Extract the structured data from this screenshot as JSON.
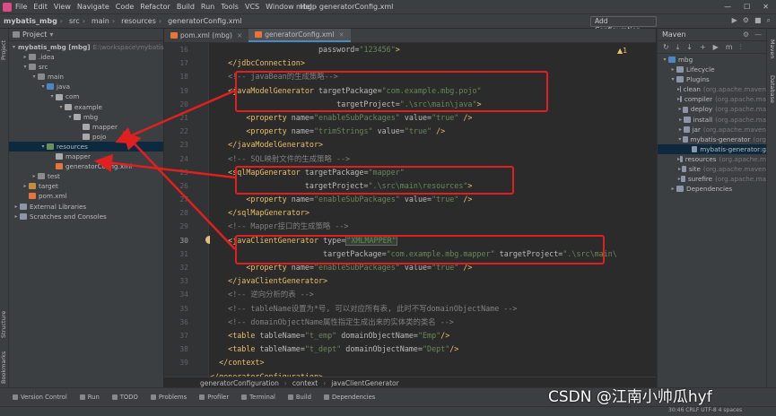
{
  "menubar": {
    "items": [
      "File",
      "Edit",
      "View",
      "Navigate",
      "Code",
      "Refactor",
      "Build",
      "Run",
      "Tools",
      "VCS",
      "Window",
      "Help"
    ],
    "title": "mbg - generatorConfig.xml"
  },
  "navbar": {
    "crumbs": [
      "mybatis_mbg",
      "src",
      "main",
      "resources",
      "generatorConfig.xml"
    ],
    "add_config": "Add Configuration..."
  },
  "left_tabs": {
    "project": "Project",
    "structure": "Structure",
    "bookmarks": "Bookmarks"
  },
  "project": {
    "header": "Project",
    "tree": [
      {
        "label": "mybatis_mbg [mbg]",
        "hint": "E:\\workspace\\mybatis",
        "depth": 0,
        "icon": "folder",
        "open": true,
        "bold": true
      },
      {
        "label": ".idea",
        "depth": 1,
        "icon": "folder",
        "open": false
      },
      {
        "label": "src",
        "depth": 1,
        "icon": "folder",
        "open": true
      },
      {
        "label": "main",
        "depth": 2,
        "icon": "folder",
        "open": true
      },
      {
        "label": "java",
        "depth": 3,
        "icon": "src",
        "open": true
      },
      {
        "label": "com",
        "depth": 4,
        "icon": "pkg",
        "open": true
      },
      {
        "label": "example",
        "depth": 5,
        "icon": "pkg",
        "open": true
      },
      {
        "label": "mbg",
        "depth": 6,
        "icon": "pkg",
        "open": true
      },
      {
        "label": "mapper",
        "depth": 7,
        "icon": "pkg",
        "open": null
      },
      {
        "label": "pojo",
        "depth": 7,
        "icon": "pkg",
        "open": null
      },
      {
        "label": "resources",
        "depth": 3,
        "icon": "res",
        "open": true,
        "selected": true
      },
      {
        "label": "mapper",
        "depth": 4,
        "icon": "pkg",
        "open": null
      },
      {
        "label": "generatorConfig.xml",
        "depth": 4,
        "icon": "xml",
        "open": null
      },
      {
        "label": "test",
        "depth": 2,
        "icon": "folder",
        "open": false
      },
      {
        "label": "target",
        "depth": 1,
        "icon": "tgt",
        "open": false
      },
      {
        "label": "pom.xml",
        "depth": 1,
        "icon": "xml",
        "open": null
      },
      {
        "label": "External Libraries",
        "depth": 0,
        "icon": "lib",
        "open": false
      },
      {
        "label": "Scratches and Consoles",
        "depth": 0,
        "icon": "lib",
        "open": false
      }
    ]
  },
  "editor": {
    "tabs": [
      {
        "label": "pom.xml (mbg)",
        "active": false
      },
      {
        "label": "generatorConfig.xml",
        "active": true
      }
    ],
    "warnings": "▲1",
    "lines": [
      16,
      17,
      18,
      19,
      20,
      21,
      22,
      23,
      24,
      25,
      26,
      27,
      28,
      29,
      30,
      31,
      32,
      33,
      34,
      35,
      36,
      37,
      38,
      39
    ],
    "code": [
      [
        [
          "att",
          "                        password="
        ],
        [
          "val",
          "\"123456\""
        ],
        [
          "tag",
          ">"
        ]
      ],
      [
        [
          "tag",
          "    </jdbcConnection>"
        ]
      ],
      [
        [
          "cmt",
          "    <!-- javaBean的生成策略-->"
        ]
      ],
      [
        [
          "tag",
          "    <javaModelGenerator "
        ],
        [
          "att",
          "targetPackage="
        ],
        [
          "val",
          "\"com.example.mbg.pojo\""
        ]
      ],
      [
        [
          "att",
          "                            targetProject="
        ],
        [
          "val",
          "\".\\src\\main\\java\""
        ],
        [
          "tag",
          ">"
        ]
      ],
      [
        [
          "tag",
          "        <property "
        ],
        [
          "att",
          "name="
        ],
        [
          "val",
          "\"enableSubPackages\" "
        ],
        [
          "att",
          "value="
        ],
        [
          "val",
          "\"true\" "
        ],
        [
          "tag",
          "/>"
        ]
      ],
      [
        [
          "tag",
          "        <property "
        ],
        [
          "att",
          "name="
        ],
        [
          "val",
          "\"trimStrings\" "
        ],
        [
          "att",
          "value="
        ],
        [
          "val",
          "\"true\" "
        ],
        [
          "tag",
          "/>"
        ]
      ],
      [
        [
          "tag",
          "    </javaModelGenerator>"
        ]
      ],
      [
        [
          "cmt",
          "    <!-- SQL映射文件的生成策略 -->"
        ]
      ],
      [
        [
          "tag",
          "    <sqlMapGenerator "
        ],
        [
          "att",
          "targetPackage="
        ],
        [
          "val",
          "\"mapper\""
        ]
      ],
      [
        [
          "att",
          "                     targetProject="
        ],
        [
          "val",
          "\".\\src\\main\\resources\""
        ],
        [
          "tag",
          ">"
        ]
      ],
      [
        [
          "tag",
          "        <property "
        ],
        [
          "att",
          "name="
        ],
        [
          "val",
          "\"enableSubPackages\" "
        ],
        [
          "att",
          "value="
        ],
        [
          "val",
          "\"true\" "
        ],
        [
          "tag",
          "/>"
        ]
      ],
      [
        [
          "tag",
          "    </sqlMapGenerator>"
        ]
      ],
      [
        [
          "cmt",
          "    <!-- Mapper接口的生成策略 -->"
        ]
      ],
      [
        [
          "tag",
          "    <javaClientGenerator "
        ],
        [
          "att",
          "type="
        ],
        [
          "hl",
          "\"XMLMAPPER\""
        ]
      ],
      [
        [
          "att",
          "                         targetPackage="
        ],
        [
          "val",
          "\"com.example.mbg.mapper\" "
        ],
        [
          "att",
          "targetProject="
        ],
        [
          "val",
          "\".\\src\\main\\"
        ]
      ],
      [
        [
          "tag",
          "        <property "
        ],
        [
          "att",
          "name="
        ],
        [
          "val",
          "\"enableSubPackages\" "
        ],
        [
          "att",
          "value="
        ],
        [
          "val",
          "\"true\" "
        ],
        [
          "tag",
          "/>"
        ]
      ],
      [
        [
          "tag",
          "    </javaClientGenerator>"
        ]
      ],
      [
        [
          "cmt",
          "    <!-- 逆向分析的表 -->"
        ]
      ],
      [
        [
          "cmt",
          "    <!-- tableName设置为*号, 可以对应所有表, 此时不写domainObjectName -->"
        ]
      ],
      [
        [
          "cmt",
          "    <!-- domainObjectName属性指定生成出来的实体类的类名 -->"
        ]
      ],
      [
        [
          "tag",
          "    <table "
        ],
        [
          "att",
          "tableName="
        ],
        [
          "val",
          "\"t_emp\" "
        ],
        [
          "att",
          "domainObjectName="
        ],
        [
          "val",
          "\"Emp\""
        ],
        [
          "tag",
          "/>"
        ]
      ],
      [
        [
          "tag",
          "    <table "
        ],
        [
          "att",
          "tableName="
        ],
        [
          "val",
          "\"t_dept\" "
        ],
        [
          "att",
          "domainObjectName="
        ],
        [
          "val",
          "\"Dept\""
        ],
        [
          "tag",
          "/>"
        ]
      ],
      [
        [
          "tag",
          "  </context>"
        ]
      ],
      [
        [
          "tag",
          "</generatorConfiguration>"
        ]
      ]
    ],
    "breadcrumb": [
      "generatorConfiguration",
      "context",
      "javaClientGenerator"
    ]
  },
  "maven": {
    "header": "Maven",
    "tree": [
      {
        "label": "mbg",
        "depth": 0,
        "open": true
      },
      {
        "label": "Lifecycle",
        "depth": 1,
        "open": false
      },
      {
        "label": "Plugins",
        "depth": 1,
        "open": true
      },
      {
        "label": "clean",
        "hint": "(org.apache.maven",
        "depth": 2,
        "open": false
      },
      {
        "label": "compiler",
        "hint": "(org.apache.ma",
        "depth": 2,
        "open": false
      },
      {
        "label": "deploy",
        "hint": "(org.apache.ma",
        "depth": 2,
        "open": false
      },
      {
        "label": "install",
        "hint": "(org.apache.ma",
        "depth": 2,
        "open": false
      },
      {
        "label": "jar",
        "hint": "(org.apache.maven",
        "depth": 2,
        "open": false
      },
      {
        "label": "mybatis-generator",
        "hint": "(org",
        "depth": 2,
        "open": true
      },
      {
        "label": "mybatis-generator:g",
        "depth": 3,
        "open": null,
        "selected": true
      },
      {
        "label": "resources",
        "hint": "(org.apache.m",
        "depth": 2,
        "open": false
      },
      {
        "label": "site",
        "hint": "(org.apache.maven",
        "depth": 2,
        "open": false
      },
      {
        "label": "surefire",
        "hint": "(org.apache.ma",
        "depth": 2,
        "open": false
      },
      {
        "label": "Dependencies",
        "depth": 1,
        "open": false
      }
    ]
  },
  "right_tabs": {
    "maven": "Maven",
    "database": "Database"
  },
  "statusbar": {
    "items": [
      "Version Control",
      "Run",
      "TODO",
      "Problems",
      "Profiler",
      "Terminal",
      "Build",
      "Dependencies"
    ],
    "position": "30:46   CRLF   UTF-8   4 spaces"
  },
  "watermark": "CSDN @江南小帅瓜hyf",
  "colors": {
    "annotation_red": "#e02020",
    "bg": "#2b2b2b",
    "panel": "#3c3f41"
  }
}
